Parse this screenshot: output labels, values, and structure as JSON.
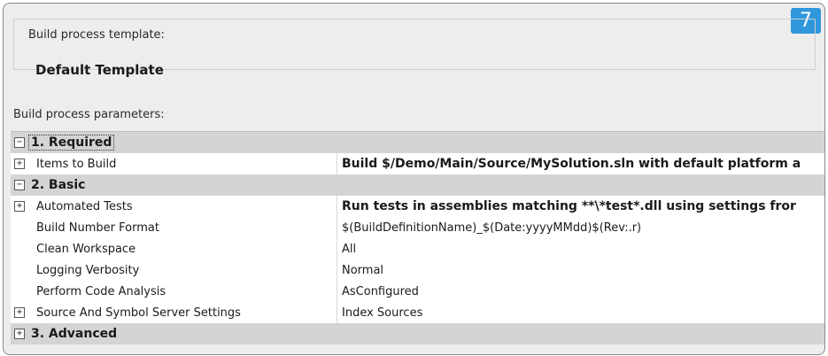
{
  "badge": "7",
  "template": {
    "legend": "Build process template:",
    "name": "Default Template"
  },
  "params_label": "Build process parameters:",
  "rows": [
    {
      "kind": "category",
      "expander": "⊟",
      "label": "1. Required"
    },
    {
      "kind": "item",
      "expander": "⊞",
      "name": "Items to Build",
      "value": "Build $/Demo/Main/Source/MySolution.sln with default platform a",
      "bold": true
    },
    {
      "kind": "category",
      "expander": "⊟",
      "label": "2. Basic"
    },
    {
      "kind": "item",
      "expander": "⊞",
      "name": "Automated Tests",
      "value": "Run tests in assemblies matching **\\*test*.dll using settings fror",
      "bold": true
    },
    {
      "kind": "item",
      "name": "Build Number Format",
      "value": "$(BuildDefinitionName)_$(Date:yyyyMMdd)$(Rev:.r)"
    },
    {
      "kind": "item",
      "name": "Clean Workspace",
      "value": "All"
    },
    {
      "kind": "item",
      "name": "Logging Verbosity",
      "value": "Normal"
    },
    {
      "kind": "item",
      "name": "Perform Code Analysis",
      "value": "AsConfigured"
    },
    {
      "kind": "item",
      "expander": "⊞",
      "name": "Source And Symbol Server Settings",
      "value": "Index Sources"
    },
    {
      "kind": "category",
      "expander": "⊞",
      "label": "3. Advanced"
    }
  ]
}
